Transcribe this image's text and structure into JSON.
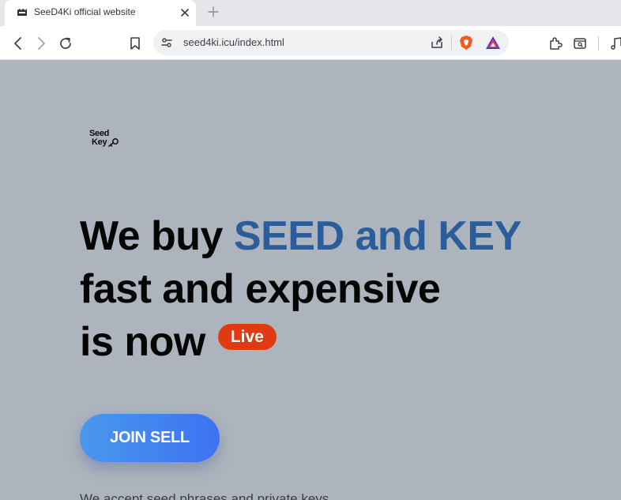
{
  "browser": {
    "tab_title": "SeeD4Ki official website",
    "url": "seed4ki.icu/index.html",
    "icons": [
      "back-icon",
      "forward-icon",
      "reload-icon",
      "bookmark-icon",
      "site-info-icon",
      "share-icon",
      "brave-shields-icon",
      "brave-rewards-icon",
      "extensions-icon",
      "tab-search-icon",
      "media-icon"
    ]
  },
  "page": {
    "logo": {
      "line1": "Seed",
      "line2": "Key"
    },
    "hero": {
      "line1_prefix": "We buy ",
      "line1_accent": "SEED and KEY",
      "line2": "fast and expensive",
      "line3": "is now",
      "live_badge": "Live"
    },
    "join_button": "JOIN SELL",
    "subtext": "We accept seed phrases and private keys"
  },
  "colors": {
    "page_background": "#adb4bd",
    "accent_text": "#2a5d9a",
    "live_badge": "#e03a12",
    "button_gradient_start": "#4a98ee",
    "button_gradient_end": "#3c72f0"
  }
}
